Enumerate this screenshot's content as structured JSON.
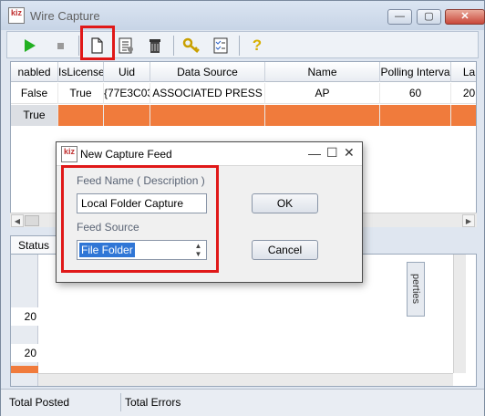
{
  "window": {
    "title": "Wire Capture",
    "app_icon_text": "kiz",
    "minimize": "—",
    "maximize": "▢",
    "close": "✕"
  },
  "toolbar": {
    "play_icon": "play-icon",
    "stop_icon": "stop-icon",
    "new_icon": "new-document-icon",
    "properties_icon": "properties-icon",
    "delete_icon": "trash-icon",
    "key_icon": "key-icon",
    "checklist_icon": "checklist-icon",
    "help_icon": "help-icon",
    "help_glyph": "?"
  },
  "grid": {
    "columns": [
      "nabled",
      "IsLicense",
      "Uid",
      "Data Source",
      "Name",
      "Polling Interva",
      "La"
    ],
    "rows": [
      {
        "cells": [
          "False",
          "True",
          "{77E3C03",
          "ASSOCIATED PRESS",
          "AP",
          "60",
          "20"
        ],
        "highlight": false
      },
      {
        "cells": [
          "True",
          "",
          "",
          "",
          "",
          "",
          ""
        ],
        "highlight": true
      }
    ]
  },
  "bottom_tabs": {
    "status": "Status",
    "properties_vertical": "perties"
  },
  "lower_list": {
    "rows": [
      "20",
      "20"
    ]
  },
  "statusbar": {
    "total_posted": "Total Posted",
    "total_errors": "Total Errors"
  },
  "dialog": {
    "title": "New Capture Feed",
    "app_icon_text": "kiz",
    "feed_name_label": "Feed Name ( Description )",
    "feed_name_value": "Local Folder Capture",
    "feed_source_label": "Feed Source",
    "feed_source_value": "File Folder",
    "ok": "OK",
    "cancel": "Cancel"
  },
  "colors": {
    "highlight_row": "#f07b3c",
    "annotation_red": "#e01818"
  }
}
